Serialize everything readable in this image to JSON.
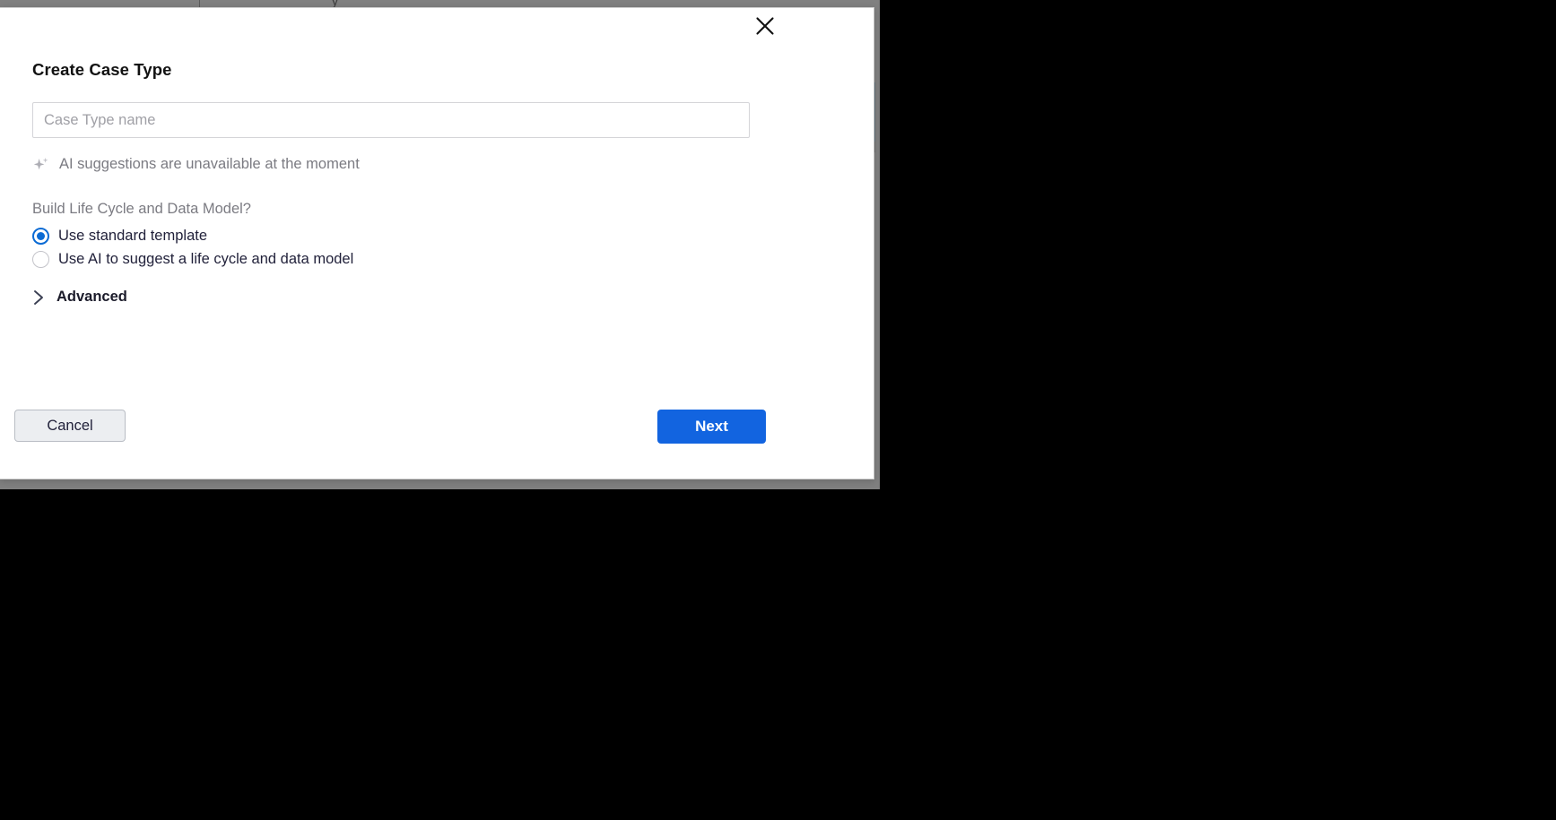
{
  "modal": {
    "title": "Create Case Type",
    "close_icon": "close-icon",
    "name_field": {
      "placeholder": "Case Type name",
      "value": ""
    },
    "ai_note": {
      "icon": "sparkle-icon",
      "text": "AI suggestions are unavailable at the moment"
    },
    "build_group": {
      "label": "Build Life Cycle and Data Model?",
      "options": [
        {
          "label": "Use standard template",
          "selected": true
        },
        {
          "label": "Use AI to suggest a life cycle and data model",
          "selected": false
        }
      ]
    },
    "advanced": {
      "label": "Advanced",
      "icon": "chevron-right-icon",
      "expanded": false
    },
    "footer": {
      "cancel_label": "Cancel",
      "next_label": "Next"
    }
  },
  "colors": {
    "accent_blue": "#1264e0",
    "radio_blue": "#0b6bd4",
    "muted_text": "#7b7b82",
    "body_text": "#22223b",
    "page_backdrop": "#808080",
    "outside_background": "#000000",
    "cancel_fill": "#eceef1",
    "side_accent": "#64747f"
  }
}
